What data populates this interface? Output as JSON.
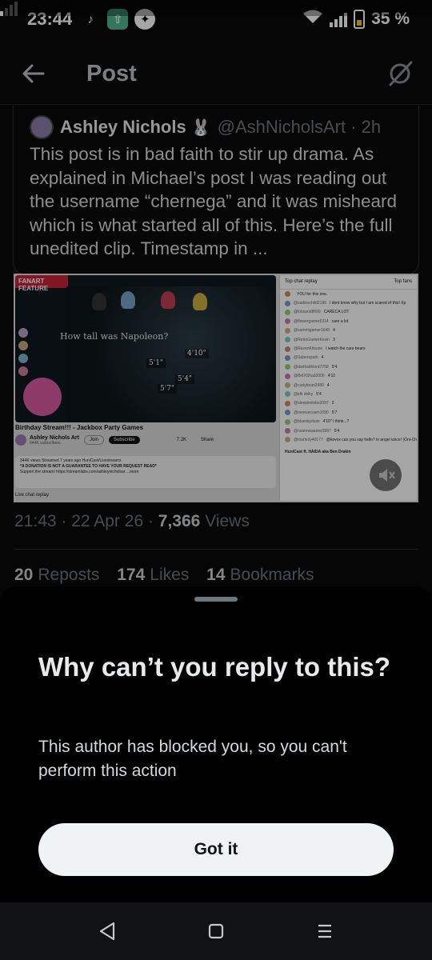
{
  "status_bar": {
    "time": "23:44",
    "battery": "35 %",
    "app_icons": [
      "tiktok-icon",
      "upload-app-icon",
      "shield-app-icon"
    ]
  },
  "top_bar": {
    "title": "Post"
  },
  "quoted_post": {
    "author_name": "Ashley Nichols",
    "author_emoji": "🐰",
    "handle_time": "@AshNicholsArt · 2h",
    "text": "This post is in bad faith to stir up drama. As explained in Michael’s post I was reading out the username “chernega” and it was misheard which is what started all of this. Here’s the full unedited clip. Timestamp in ..."
  },
  "media": {
    "video_banner": "FANART FEATURE",
    "video_question": "How tall was Napoleon?",
    "answers": [
      "4'10\"",
      "5'1\"",
      "5'4\"",
      "5'7\""
    ],
    "video_title": "Birthday Stream!!! - Jackbox Party Games",
    "channel_name": "Ashley Nichols Art",
    "channel_subs": "644K subscribers",
    "join_label": "Join",
    "subscribe_label": "Subscribe",
    "like_count": "7.2K",
    "share_label": "Share",
    "desc_line1": "344K views  Streamed 7 years ago  HuniCast/Livestreams",
    "desc_line2": "*A DONATION IS NOT A GUARANTEE TO HAVE YOUR REQUEST READ*",
    "desc_line3": "Support the stream! https://streamlabs.com/ashleynicholsar  ...more",
    "live_replay": "Live chat replay",
    "chat_header": "Top chat replay",
    "chat_top_fans": "Top fans",
    "chat_messages": [
      {
        "user": "",
        "text": "YOU for this one."
      },
      {
        "user": "@sadieschild2196",
        "text": "I dont know why but I am scared of this! Xp"
      },
      {
        "user": "@lobsand8699",
        "text": "CARECA LOT"
      },
      {
        "user": "@flowergamer6314",
        "text": "care a lot"
      },
      {
        "user": "@sammigamer1649",
        "text": "4"
      },
      {
        "user": "@RetroGamerKevin",
        "text": "3"
      },
      {
        "user": "@RavenKitsune",
        "text": "I watch the care bears"
      },
      {
        "user": "@Saberspark",
        "text": "4"
      },
      {
        "user": "@darthsithlord7758",
        "text": "5'4"
      },
      {
        "user": "@BritXShad2006",
        "text": "4'10"
      },
      {
        "user": "@curlybean2980",
        "text": "4"
      },
      {
        "user": "@idk dvlky",
        "text": "5'4"
      },
      {
        "user": "@sleepleslobs2097",
        "text": "2"
      },
      {
        "user": "@neonarcsam1090",
        "text": "5'7"
      },
      {
        "user": "@blueskydusk",
        "text": "4'10\" I think...?"
      },
      {
        "user": "@rwarewwarew3997",
        "text": "5'4"
      },
      {
        "user": "@marlerly40177",
        "text": "@kovox can you say hello? in angel voice! (Oni-Chan-owans birthday)"
      }
    ],
    "chat_footer": "HuniCast ft. HAIDA aka Ben Drakin"
  },
  "post_meta": {
    "time_date": "21:43 · 22 Apr 26 · ",
    "views_count": "7,366",
    "views_label": " Views"
  },
  "stats": {
    "reposts_count": "20",
    "reposts_label": "Reposts",
    "likes_count": "174",
    "likes_label": "Likes",
    "bookmarks_count": "14",
    "bookmarks_label": "Bookmarks"
  },
  "sheet": {
    "title": "Why can’t you reply to this?",
    "body": "This author has blocked you, so you can't perform this action",
    "button": "Got it"
  },
  "colors": {
    "background": "#000000",
    "button_bg": "#eff3f4",
    "muted_text": "#6e767d"
  }
}
